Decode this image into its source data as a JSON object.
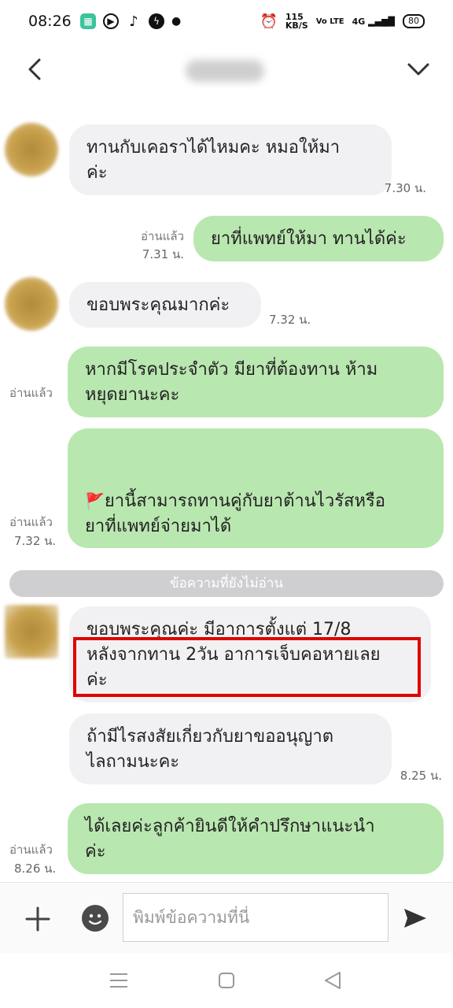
{
  "status_bar": {
    "time": "08:26",
    "speed": "115\nKB/S",
    "network": "Vo LTE",
    "signal": "4G",
    "battery": "80"
  },
  "messages": [
    {
      "dir": "in",
      "text": "ทานกับเคอราได้ไหมคะ หมอให้มา\nค่ะ",
      "time": "7.30 น."
    },
    {
      "dir": "out",
      "text": "ยาที่แพทย์ให้มา ทานได้ค่ะ",
      "read": "อ่านแล้ว",
      "time": "7.31 น."
    },
    {
      "dir": "in",
      "text": "ขอบพระคุณมากค่ะ",
      "time": "7.32 น."
    },
    {
      "dir": "out",
      "text": "หากมีโรคประจำตัว มียาที่ต้องทาน ห้าม\nหยุดยานะคะ",
      "read": "อ่านแล้ว"
    },
    {
      "dir": "out",
      "text": "ยานี้สามารถทานคู่กับยาต้านไวรัสหรือ\nยาที่แพทย์จ่ายมาได้",
      "read": "อ่านแล้ว",
      "time": "7.32 น."
    },
    {
      "dir": "in",
      "text": "ขอบพระคุณค่ะ มีอาการตั้งแต่ 17/8\nหลังจากทาน 2วัน  อาการเจ็บคอหายเลย\nค่ะ"
    },
    {
      "dir": "in",
      "text": "ถ้ามีไรสงสัยเกี่ยวกับยาขออนุญาต\nไลถามนะคะ",
      "time": "8.25 น."
    },
    {
      "dir": "out",
      "text": "ได้เลยค่ะลูกค้ายินดีให้คำปรึกษาแนะนำ\nค่ะ",
      "read": "อ่านแล้ว",
      "time": "8.26 น."
    }
  ],
  "unread_divider": "ข้อความที่ยังไม่อ่าน",
  "composer": {
    "placeholder": "พิมพ์ข้อความที่นี่"
  },
  "colors": {
    "incoming_bubble": "#f1f1f3",
    "outgoing_bubble": "#b9e7b0",
    "highlight_box": "#e00000"
  },
  "icons": [
    "back-icon",
    "chevron-down-icon",
    "plus-icon",
    "emoji-icon",
    "send-icon",
    "flag-icon",
    "nav-menu-icon",
    "nav-home-icon",
    "nav-back-icon"
  ]
}
